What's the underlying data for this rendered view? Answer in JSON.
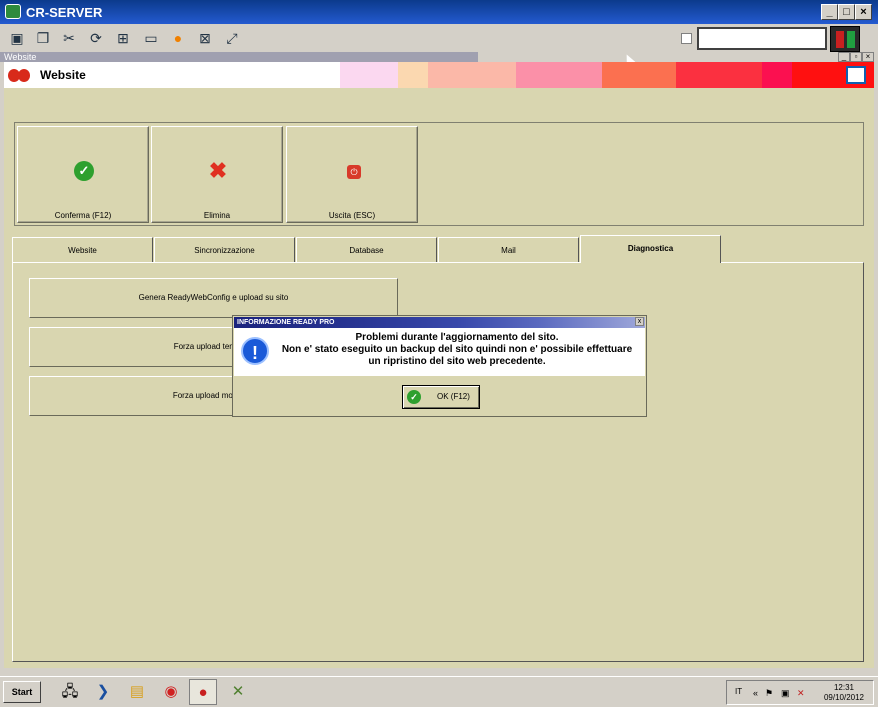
{
  "window": {
    "title": "CR-SERVER",
    "min": "_",
    "max": "□",
    "close": "×"
  },
  "toolbar": {
    "icons": [
      "monitor-icon",
      "windows-icon",
      "tools-icon",
      "refresh-icon",
      "windows-logo-icon",
      "drive-icon",
      "warning-icon",
      "network-error-icon",
      "fullscreen-icon"
    ],
    "input_value": ""
  },
  "mdi": {
    "title": "Website"
  },
  "header": {
    "title": "Website"
  },
  "actions": [
    {
      "label": "Conferma (F12)",
      "icon": "check-icon"
    },
    {
      "label": "Elimina",
      "icon": "delete-x-icon"
    },
    {
      "label": "Uscita (ESC)",
      "icon": "exit-icon"
    }
  ],
  "tabs": [
    {
      "label": "Website"
    },
    {
      "label": "Sincronizzazione"
    },
    {
      "label": "Database"
    },
    {
      "label": "Mail"
    },
    {
      "label": "Diagnostica"
    }
  ],
  "active_tab": "Diagnostica",
  "diagnostics": [
    {
      "label": "Genera ReadyWebConfig e upload su sito"
    },
    {
      "label": "Forza upload template"
    },
    {
      "label": "Forza upload motore E"
    }
  ],
  "dialog": {
    "title": "INFORMAZIONE READY PRO",
    "close": "x",
    "message": [
      "Problemi durante l'aggiornamento del sito.",
      "Non e' stato eseguito un backup del sito quindi non e' possibile effettuare",
      "un ripristino del sito web precedente."
    ],
    "ok_label": "OK (F12)"
  },
  "taskbar": {
    "start_label": "Start",
    "apps": [
      "server-manager-icon",
      "powershell-icon",
      "explorer-icon",
      "chrome-icon",
      "strawberry-app-icon",
      "network-tool-icon"
    ],
    "language": "IT",
    "time": "12:31",
    "date": "09/10/2012"
  }
}
